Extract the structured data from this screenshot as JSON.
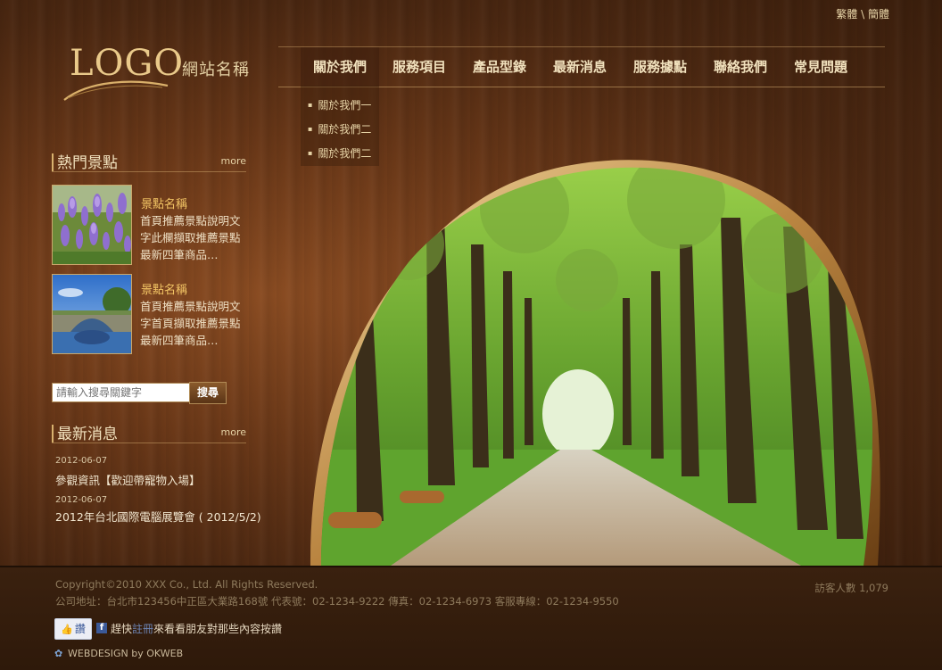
{
  "header": {
    "lang_traditional": "繁體",
    "lang_separator": "\\",
    "lang_simplified": "簡體",
    "logo_text": "LOGO",
    "site_name": "網站名稱"
  },
  "nav": {
    "items": [
      {
        "label": "關於我們"
      },
      {
        "label": "服務項目"
      },
      {
        "label": "產品型錄"
      },
      {
        "label": "最新消息"
      },
      {
        "label": "服務據點"
      },
      {
        "label": "聯絡我們"
      },
      {
        "label": "常見問題"
      }
    ],
    "submenu": [
      {
        "label": "關於我們一"
      },
      {
        "label": "關於我們二"
      },
      {
        "label": "關於我們二"
      }
    ]
  },
  "hot_spots": {
    "title": "熱門景點",
    "more": "more",
    "items": [
      {
        "name": "景點名稱",
        "desc": "首頁推薦景點說明文字此欄擷取推薦景點最新四筆商品…",
        "image": "lavender-field"
      },
      {
        "name": "景點名稱",
        "desc": "首頁推薦景點說明文字首頁擷取推薦景點最新四筆商品…",
        "image": "stone-bridge"
      }
    ]
  },
  "search": {
    "placeholder": "請輸入搜尋關鍵字",
    "button": "搜尋"
  },
  "news": {
    "title": "最新消息",
    "more": "more",
    "items": [
      {
        "date": "2012-06-07",
        "title": "參觀資訊【歡迎帶寵物入場】"
      },
      {
        "date": "2012-06-07",
        "title": "2012年台北國際電腦展覽會 ( 2012/5/2)"
      }
    ]
  },
  "footer": {
    "copyright": "Copyright©2010 XXX Co., Ltd. All Rights Reserved.",
    "address": "公司地址：台北市123456中正區大業路168號 代表號：02-1234-9222 傳真：02-1234-6973 客服專線：02-1234-9550",
    "visitors": "訪客人數 1,079",
    "like_label": "讚",
    "fb_prefix": "趕快",
    "fb_register": "註冊",
    "fb_suffix": "來看看朋友對那些內容按讚",
    "credit": "WEBDESIGN by OKWEB"
  },
  "colors": {
    "accent_gold": "#e9c98a",
    "item_name": "#f3c565",
    "wood_dark": "#3a1e0c"
  }
}
